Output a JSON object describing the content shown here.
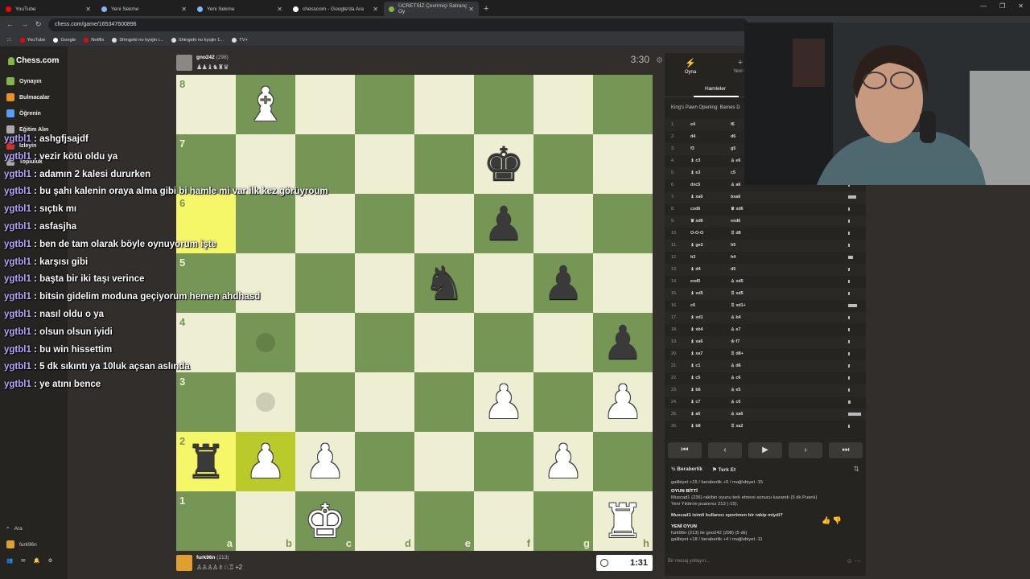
{
  "browser": {
    "tabs": [
      {
        "title": "YouTube",
        "color": "#ff0000"
      },
      {
        "title": "Yeni Sekme",
        "color": "#8ab4f8"
      },
      {
        "title": "Yeni Sekme",
        "color": "#8ab4f8"
      },
      {
        "title": "chesscom - Google'da Ara",
        "color": "#ffffff"
      },
      {
        "title": "ÜCRETSİZ Çevrimiçi Satranç Oy",
        "color": "#81b64c"
      }
    ],
    "url": "chess.com/game/165347600896",
    "bookmarks": [
      {
        "label": "YouTube",
        "color": "#ff0000"
      },
      {
        "label": "Google",
        "color": "#ffffff"
      },
      {
        "label": "Netflix",
        "color": "#e50914"
      },
      {
        "label": "Shingeki no kyojin i...",
        "color": "#dddddd"
      },
      {
        "label": "Shingeki no kyojin 1...",
        "color": "#dddddd"
      },
      {
        "label": "TV+",
        "color": "#dddddd"
      }
    ]
  },
  "sidebar": {
    "logo": "Chess.com",
    "items": [
      {
        "label": "Oynayın",
        "color": "#81b64c"
      },
      {
        "label": "Bulmacalar",
        "color": "#e6912c"
      },
      {
        "label": "Öğrenin",
        "color": "#5d9cec"
      },
      {
        "label": "Eğitim Alın",
        "color": "#aaaaaa"
      },
      {
        "label": "İzleyin",
        "color": "#cc3333"
      },
      {
        "label": "Topluluk",
        "color": "#aaaaaa"
      }
    ],
    "search": "Ara",
    "username": "furk96n"
  },
  "chat": [
    {
      "user": "ygtbl1",
      "msg": "ashgfjsajdf"
    },
    {
      "user": "ygtbl1",
      "msg": "vezir kötü oldu ya"
    },
    {
      "user": "ygtbl1",
      "msg": "adamın 2 kalesi dururken"
    },
    {
      "user": "ygtbl1",
      "msg": "bu şahı kalenin oraya alma gibi bi hamle mi var ilk kez görüyroum"
    },
    {
      "user": "ygtbl1",
      "msg": "sıçtık mı"
    },
    {
      "user": "ygtbl1",
      "msg": "asfasjha"
    },
    {
      "user": "ygtbl1",
      "msg": "ben de tam olarak böyle oynuyorum işte"
    },
    {
      "user": "ygtbl1",
      "msg": "karşısı gibi"
    },
    {
      "user": "ygtbl1",
      "msg": "başta bir iki taşı verince"
    },
    {
      "user": "ygtbl1",
      "msg": "bitsin gidelim moduna geçiyorum hemen ahdhasd"
    },
    {
      "user": "ygtbl1",
      "msg": "nasıl oldu o ya"
    },
    {
      "user": "ygtbl1",
      "msg": "olsun olsun iyidi"
    },
    {
      "user": "ygtbl1",
      "msg": "bu win hissettim"
    },
    {
      "user": "ygtbl1",
      "msg": "5 dk sıkıntı ya 10luk açsan aslında"
    },
    {
      "user": "ygtbl1",
      "msg": "ye atını bence"
    }
  ],
  "opponent": {
    "name": "gno242",
    "rating": "(298)",
    "captured": "♟♟♝♞♜♛",
    "clock": "3:30"
  },
  "player": {
    "name": "furk96n",
    "rating": "(213)",
    "captured": "♙♙♙♙♗♘♖ +2",
    "clock": "1:31"
  },
  "board": {
    "ranks": [
      "8",
      "7",
      "6",
      "5",
      "4",
      "3",
      "2",
      "1"
    ],
    "files": [
      "a",
      "b",
      "c",
      "d",
      "e",
      "f",
      "g",
      "h"
    ],
    "highlighted": [
      "a6",
      "a2",
      "b2"
    ],
    "hints": [
      "b4",
      "b3"
    ],
    "pieces": {
      "b8": {
        "glyph": "♝",
        "color": "w"
      },
      "f7": {
        "glyph": "♚",
        "color": "b"
      },
      "f6": {
        "glyph": "♟",
        "color": "b"
      },
      "e5": {
        "glyph": "♞",
        "color": "b"
      },
      "g5": {
        "glyph": "♟",
        "color": "b"
      },
      "h4": {
        "glyph": "♟",
        "color": "b"
      },
      "f3": {
        "glyph": "♟",
        "color": "w"
      },
      "h3": {
        "glyph": "♟",
        "color": "w"
      },
      "a2": {
        "glyph": "♜",
        "color": "b"
      },
      "b2": {
        "glyph": "♟",
        "color": "w"
      },
      "c2": {
        "glyph": "♟",
        "color": "w"
      },
      "g2": {
        "glyph": "♟",
        "color": "w"
      },
      "c1": {
        "glyph": "♚",
        "color": "w"
      },
      "h1": {
        "glyph": "♜",
        "color": "w"
      }
    }
  },
  "panel": {
    "tabs": [
      {
        "label": "Oyna",
        "icon": "⚡"
      },
      {
        "label": "Yeni O",
        "icon": "+"
      }
    ],
    "subtab": "Hamleler",
    "opening": "King's Pawn Opening: Barnes D",
    "moves": [
      {
        "n": "1.",
        "w": "e4",
        "b": "f6",
        "t": 0.05
      },
      {
        "n": "2.",
        "w": "d4",
        "b": "d6",
        "t": 0.05
      },
      {
        "n": "3.",
        "w": "f3",
        "b": "g5",
        "t": 0.05
      },
      {
        "n": "4.",
        "w": "♝ c3",
        "b": "♙ e6",
        "t": 0.05
      },
      {
        "n": "5.",
        "w": "♝ e3",
        "b": "c5",
        "t": 0.05
      },
      {
        "n": "6.",
        "w": "dxc5",
        "b": "♙ a6",
        "t": 0.05
      },
      {
        "n": "7.",
        "w": "♝ xa6",
        "b": "bxa6",
        "t": 0.6
      },
      {
        "n": "8.",
        "w": "cxd6",
        "b": "♛ xd6",
        "t": 0.1
      },
      {
        "n": "9.",
        "w": "♛ xd6",
        "b": "exd6",
        "t": 0.1
      },
      {
        "n": "10.",
        "w": "O-O-O",
        "b": "♖ d8",
        "t": 0.1
      },
      {
        "n": "11.",
        "w": "♝ ge2",
        "b": "h5",
        "t": 0.1
      },
      {
        "n": "12.",
        "w": "h3",
        "b": "h4",
        "t": 0.4
      },
      {
        "n": "13.",
        "w": "♝ d4",
        "b": "d5",
        "t": 0.1
      },
      {
        "n": "14.",
        "w": "exd5",
        "b": "♙ xd5",
        "t": 0.1
      },
      {
        "n": "15.",
        "w": "♝ xd5",
        "b": "♖ xd5",
        "t": 0.1
      },
      {
        "n": "16.",
        "w": "c6",
        "b": "♖ xd1+",
        "t": 0.7
      },
      {
        "n": "17.",
        "w": "♝ xd1",
        "b": "♙ b4",
        "t": 0.1
      },
      {
        "n": "18.",
        "w": "♝ xb4",
        "b": "♙ e7",
        "t": 0.1
      },
      {
        "n": "19.",
        "w": "♝ xa6",
        "b": "♔ f7",
        "t": 0.1
      },
      {
        "n": "20.",
        "w": "♝ xa7",
        "b": "♖ d8+",
        "t": 0.1
      },
      {
        "n": "21.",
        "w": "♝ c1",
        "b": "♙ d6",
        "t": 0.1
      },
      {
        "n": "22.",
        "w": "♝ c5",
        "b": "♙ c6",
        "t": 0.1
      },
      {
        "n": "23.",
        "w": "♝ b6",
        "b": "♙ e5",
        "t": 0.1
      },
      {
        "n": "24.",
        "w": "♝ c7",
        "b": "♙ c6",
        "t": 0.2
      },
      {
        "n": "25.",
        "w": "♝ a6",
        "b": "♙ xa6",
        "t": 1.0
      },
      {
        "n": "26.",
        "w": "♝ b8",
        "b": "♖ xa2",
        "t": 0.1
      }
    ],
    "controls": [
      "⏮",
      "‹",
      "▶",
      "›",
      "⏭"
    ],
    "draw": "Beraberlik",
    "resign": "Terk Et",
    "log": {
      "stats_prev": "galibiyet +15 / beraberlik +0 / mağlubiyet -15",
      "game_over": "OYUN BİTTİ",
      "result": "Muscad1 (236) rakibin oyunu terk etmesi sonucu kazandı (5 dk Puanlı)",
      "new_rating": "Yeni Yıldırım puanınız 213 (-15).",
      "sportsman": "Muscad1 isimli kullanıcı sportmen bir rakip miydi?",
      "new_game": "YENİ OYUN",
      "matchup": "furk96n (213) ile gno242 (298) (5 dk)",
      "stats_new": "galibiyet +18 / beraberlik +4 / mağlubiyet -11"
    },
    "message_placeholder": "Bir mesaj yollayın..."
  }
}
